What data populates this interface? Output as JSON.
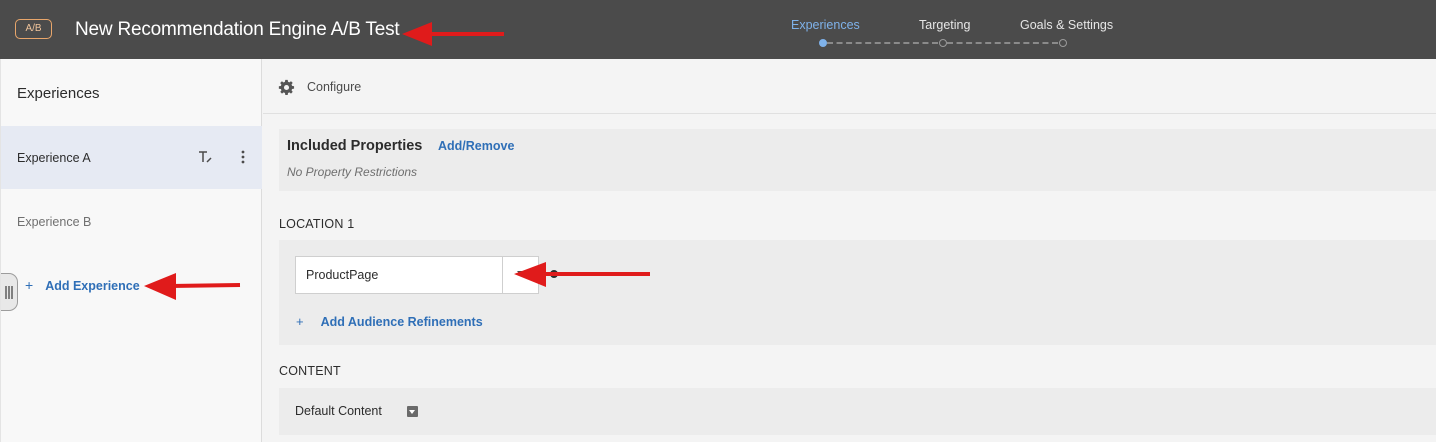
{
  "header": {
    "activity_badge": "A/B",
    "activity_title": "New Recommendation Engine A/B Test",
    "steps": [
      {
        "label": "Experiences",
        "active": true
      },
      {
        "label": "Targeting",
        "active": false
      },
      {
        "label": "Goals & Settings",
        "active": false
      }
    ]
  },
  "sidebar": {
    "heading": "Experiences",
    "experiences": [
      {
        "label": "Experience A",
        "selected": true
      },
      {
        "label": "Experience B",
        "selected": false
      }
    ],
    "add_experience_plus": "+",
    "add_experience_label": "Add Experience"
  },
  "configure": {
    "label": "Configure",
    "icon": "gear-icon"
  },
  "included_properties": {
    "title": "Included Properties",
    "link": "Add/Remove",
    "note": "No Property Restrictions"
  },
  "location": {
    "heading": "LOCATION 1",
    "selected_value": "ProductPage",
    "add_refinements_plus": "+",
    "add_refinements_label": "Add Audience Refinements"
  },
  "content": {
    "heading": "CONTENT",
    "default_label": "Default Content"
  },
  "colors": {
    "topbar": "#4b4b4b",
    "accent_blue": "#2f6fb7",
    "active_step": "#7fb2ea",
    "badge_orange": "#e8a66b",
    "annotation_red": "#e01b1b"
  }
}
